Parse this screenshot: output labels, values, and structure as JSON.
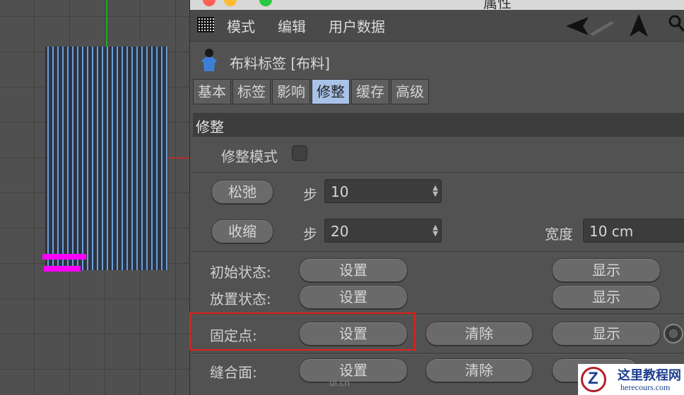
{
  "window": {
    "title": "属性"
  },
  "menubar": {
    "items": [
      "模式",
      "编辑",
      "用户数据"
    ]
  },
  "tag": {
    "title": "布料标签 [布料]"
  },
  "tabs": [
    {
      "label": "基本",
      "active": false
    },
    {
      "label": "标签",
      "active": false
    },
    {
      "label": "影响",
      "active": false
    },
    {
      "label": "修整",
      "active": true
    },
    {
      "label": "缓存",
      "active": false
    },
    {
      "label": "高级",
      "active": false
    }
  ],
  "section": {
    "title": "修整"
  },
  "dress_mode": {
    "label": "修整模式",
    "checked": false
  },
  "relax": {
    "button": "松弛",
    "step_label": "步",
    "step_value": "10"
  },
  "shrink": {
    "button": "收缩",
    "step_label": "步",
    "step_value": "20",
    "width_label": "宽度",
    "width_value": "10 cm"
  },
  "init_state": {
    "label": "初始状态:",
    "set": "设置",
    "show": "显示"
  },
  "dress_state": {
    "label": "放置状态:",
    "set": "设置",
    "show": "显示"
  },
  "fix_points": {
    "label": "固定点:",
    "set": "设置",
    "clear": "清除",
    "show": "显示"
  },
  "seam_polys": {
    "label": "缝合面:",
    "set": "设置",
    "clear": "清除",
    "show": "显示"
  },
  "watermark": {
    "title": "这里教程网",
    "subtitle": "herecours.com",
    "logo_letter": "Z"
  },
  "uicn_mark": "ui.cn",
  "colors": {
    "active_tab": "#a9c3e8",
    "highlight": "#e0201a",
    "cloth_blue": "#6aa0d8",
    "magenta": "#ff00ff"
  }
}
